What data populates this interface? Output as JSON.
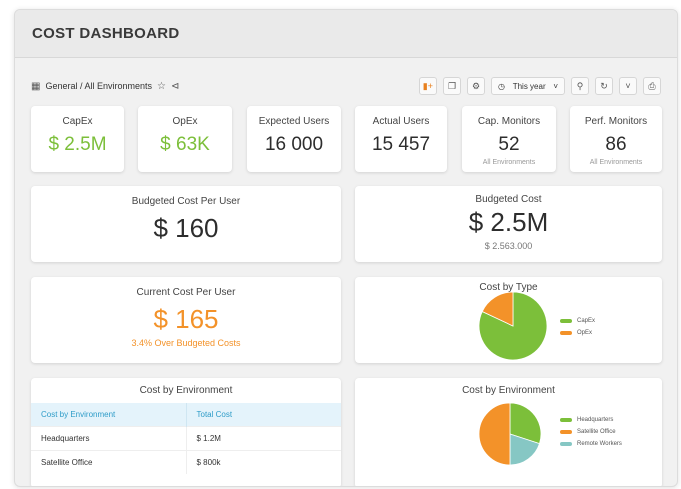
{
  "header": {
    "title": "COST DASHBOARD"
  },
  "toolbar": {
    "breadcrumb": "General / All Environments",
    "period": "This year",
    "icons": [
      "grid-icon",
      "star-icon",
      "share-icon",
      "chart-add-icon",
      "copy-icon",
      "settings-icon",
      "clock-icon",
      "zoom-icon",
      "refresh-icon",
      "print-icon"
    ]
  },
  "kpis": [
    {
      "label": "CapEx",
      "value": "$ 2.5M",
      "sub": ""
    },
    {
      "label": "OpEx",
      "value": "$ 63K",
      "sub": ""
    },
    {
      "label": "Expected Users",
      "value": "16 000",
      "sub": ""
    },
    {
      "label": "Actual Users",
      "value": "15 457",
      "sub": ""
    },
    {
      "label": "Cap. Monitors",
      "value": "52",
      "sub": "All Environments"
    },
    {
      "label": "Perf. Monitors",
      "value": "86",
      "sub": "All Environments"
    }
  ],
  "budgeted_cost_per_user": {
    "label": "Budgeted Cost Per User",
    "value": "$ 160"
  },
  "budgeted_cost": {
    "label": "Budgeted Cost",
    "value": "$ 2.5M",
    "sub": "$ 2.563.000"
  },
  "current_cost_per_user": {
    "label": "Current Cost Per User",
    "value": "$ 165",
    "sub": "3.4% Over Budgeted Costs"
  },
  "cost_by_type": {
    "title": "Cost by Type",
    "legend": [
      "CapEx",
      "OpEx"
    ]
  },
  "env_table": {
    "title": "Cost by Environment",
    "columns": [
      "Cost by Environment",
      "Total Cost"
    ],
    "rows": [
      [
        "Headquarters",
        "$ 1.2M"
      ],
      [
        "Satellite Office",
        "$ 800k"
      ]
    ]
  },
  "cost_by_env_chart": {
    "title": "Cost by Environment",
    "legend": [
      "Headquarters",
      "Satellite Office",
      "Remote Workers"
    ]
  },
  "colors": {
    "green": "#7cbf3a",
    "orange": "#f39229",
    "teal": "#86c7c4",
    "accent_blue": "#2e9cc8"
  },
  "chart_data": [
    {
      "type": "pie",
      "title": "Cost by Type",
      "categories": [
        "CapEx",
        "OpEx"
      ],
      "values": [
        82,
        18
      ]
    },
    {
      "type": "pie",
      "title": "Cost by Environment",
      "categories": [
        "Headquarters",
        "Satellite Office",
        "Remote Workers"
      ],
      "values": [
        30,
        50,
        20
      ]
    }
  ]
}
